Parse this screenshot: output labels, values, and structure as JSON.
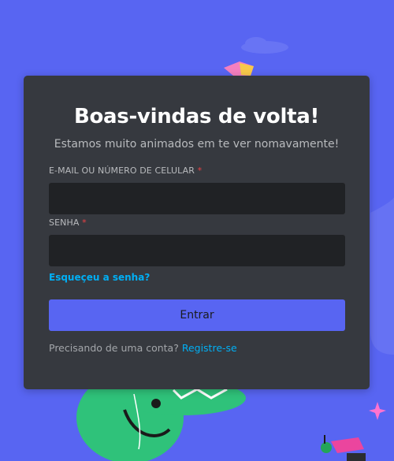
{
  "colors": {
    "background": "#5865f2",
    "card": "#36393f",
    "input": "#202225",
    "link": "#00aff4",
    "button": "#5865f2",
    "required": "#ed4245"
  },
  "login": {
    "title": "Boas-vindas de volta!",
    "subtitle": "Estamos muito animados em te ver nomavamente!",
    "email_label": "E-MAIL OU NÚMERO DE CELULAR",
    "email_value": "",
    "password_label": "SENHA",
    "password_value": "",
    "required_mark": "*",
    "forgot_password": "Esqueçeu a senha?",
    "submit_label": "Entrar",
    "register_prompt": "Precisando de uma conta?",
    "register_link": "Registre-se"
  }
}
